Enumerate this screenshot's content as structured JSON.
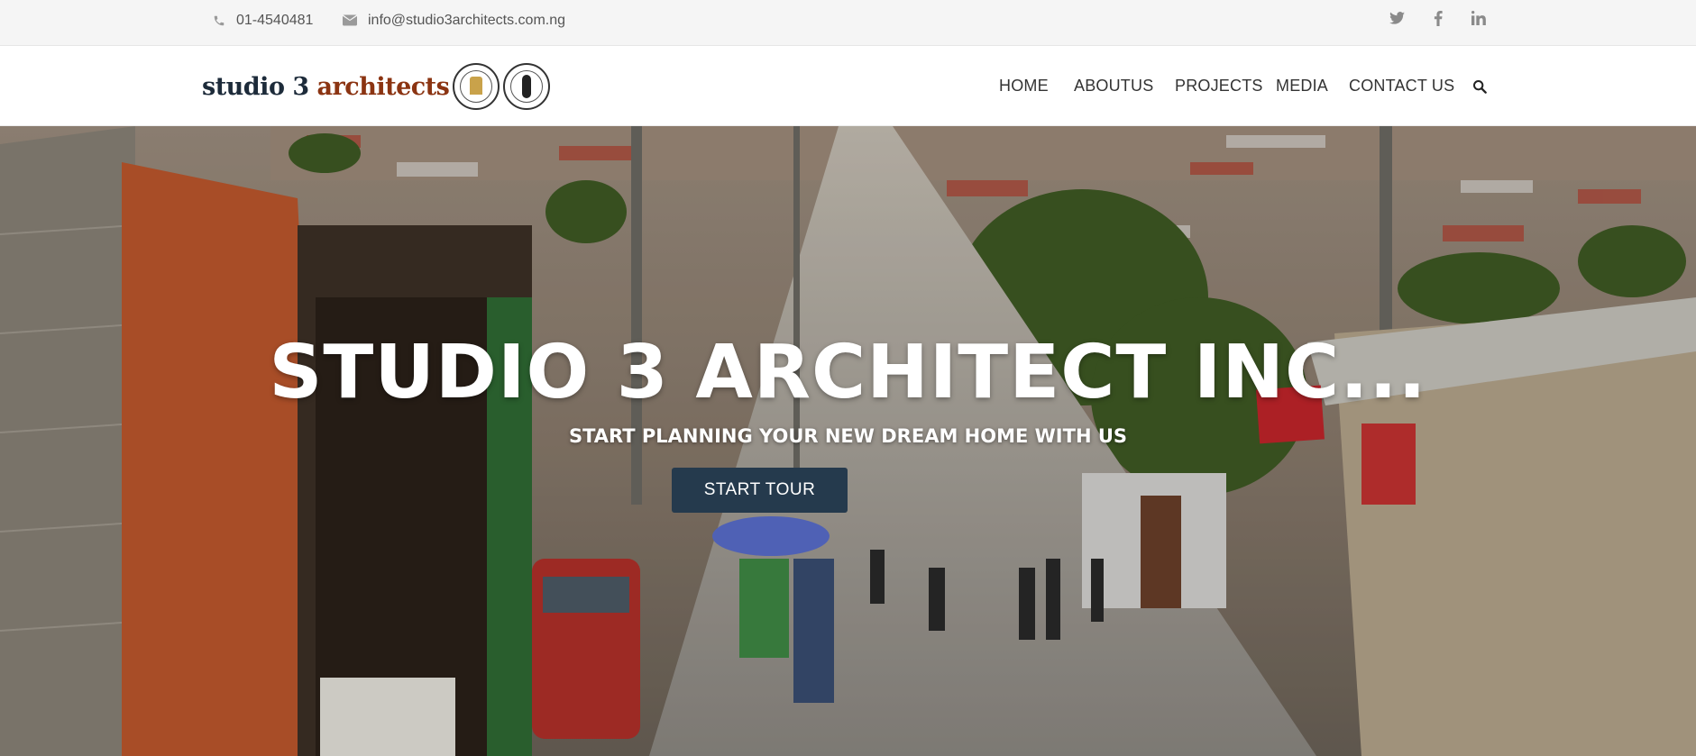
{
  "topbar": {
    "phone": "01-4540481",
    "email": "info@studio3architects.com.ng",
    "social": [
      "twitter-icon",
      "facebook-icon",
      "linkedin-icon"
    ]
  },
  "header": {
    "logo": {
      "word1": "studio 3",
      "word2": "architects",
      "text_color": "#1d2b3a",
      "accent_color": "#8b3412"
    },
    "nav": {
      "home": "HOME",
      "about": "ABOUTUS",
      "projects": "PROJECTS",
      "media": "MEDIA",
      "contact": "CONTACT US",
      "search_icon": "search-icon"
    }
  },
  "hero": {
    "title": "STUDIO 3 ARCHITECT INC...",
    "subtitle": "START PLANNING YOUR NEW DREAM HOME WITH US",
    "button": "START TOUR",
    "button_color": "#253a4d"
  }
}
